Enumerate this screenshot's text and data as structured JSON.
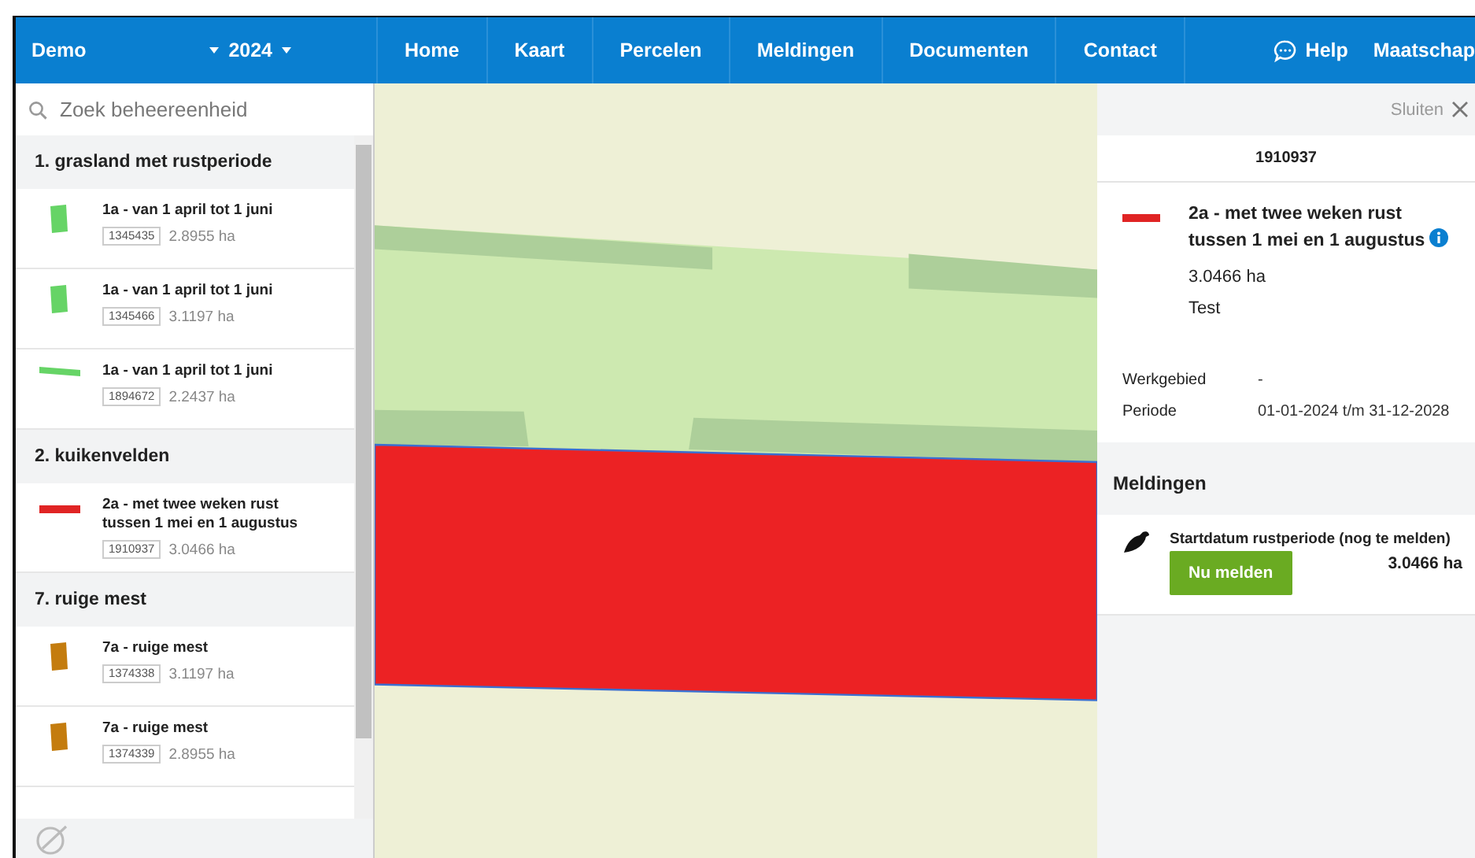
{
  "header": {
    "organisation": "Demo",
    "year": "2024",
    "nav": [
      {
        "label": "Home"
      },
      {
        "label": "Kaart"
      },
      {
        "label": "Percelen"
      },
      {
        "label": "Meldingen"
      },
      {
        "label": "Documenten"
      },
      {
        "label": "Contact"
      }
    ],
    "help": "Help",
    "account": "Maatschap"
  },
  "sidebar": {
    "search": {
      "placeholder": "Zoek beheereenheid"
    },
    "groups": [
      {
        "title": "1. grasland met rustperiode",
        "items": [
          {
            "title": "1a - van 1 april tot 1 juni",
            "code": "1345435",
            "area": "2.8955 ha",
            "kind": "block",
            "color": "#66d466"
          },
          {
            "title": "1a - van 1 april tot 1 juni",
            "code": "1345466",
            "area": "3.1197 ha",
            "kind": "block",
            "color": "#66d466"
          },
          {
            "title": "1a - van 1 april tot 1 juni",
            "code": "1894672",
            "area": "2.2437 ha",
            "kind": "strip",
            "color": "#66d466"
          }
        ]
      },
      {
        "title": "2. kuikenvelden",
        "items": [
          {
            "title": "2a - met twee weken rust tussen 1 mei en 1 augustus",
            "code": "1910937",
            "area": "3.0466 ha",
            "kind": "line",
            "color": "#e02424"
          }
        ]
      },
      {
        "title": "7. ruige mest",
        "items": [
          {
            "title": "7a - ruige mest",
            "code": "1374338",
            "area": "3.1197 ha",
            "kind": "block",
            "color": "#c47c0e"
          },
          {
            "title": "7a - ruige mest",
            "code": "1374339",
            "area": "2.8955 ha",
            "kind": "block",
            "color": "#c47c0e"
          }
        ]
      }
    ]
  },
  "detail": {
    "close": "Sluiten",
    "code": "1910937",
    "title": "2a - met twee weken rust tussen 1 mei en 1 augustus",
    "color": "#e02424",
    "area": "3.0466 ha",
    "note": "Test",
    "properties": [
      {
        "label": "Werkgebied",
        "value": "-"
      },
      {
        "label": "Periode",
        "value": "01-01-2024 t/m 31-12-2028"
      }
    ],
    "notifications_title": "Meldingen",
    "notifications": [
      {
        "text": "Startdatum rustperiode (nog te melden)",
        "area": "3.0466 ha",
        "action": "Nu melden"
      }
    ]
  }
}
